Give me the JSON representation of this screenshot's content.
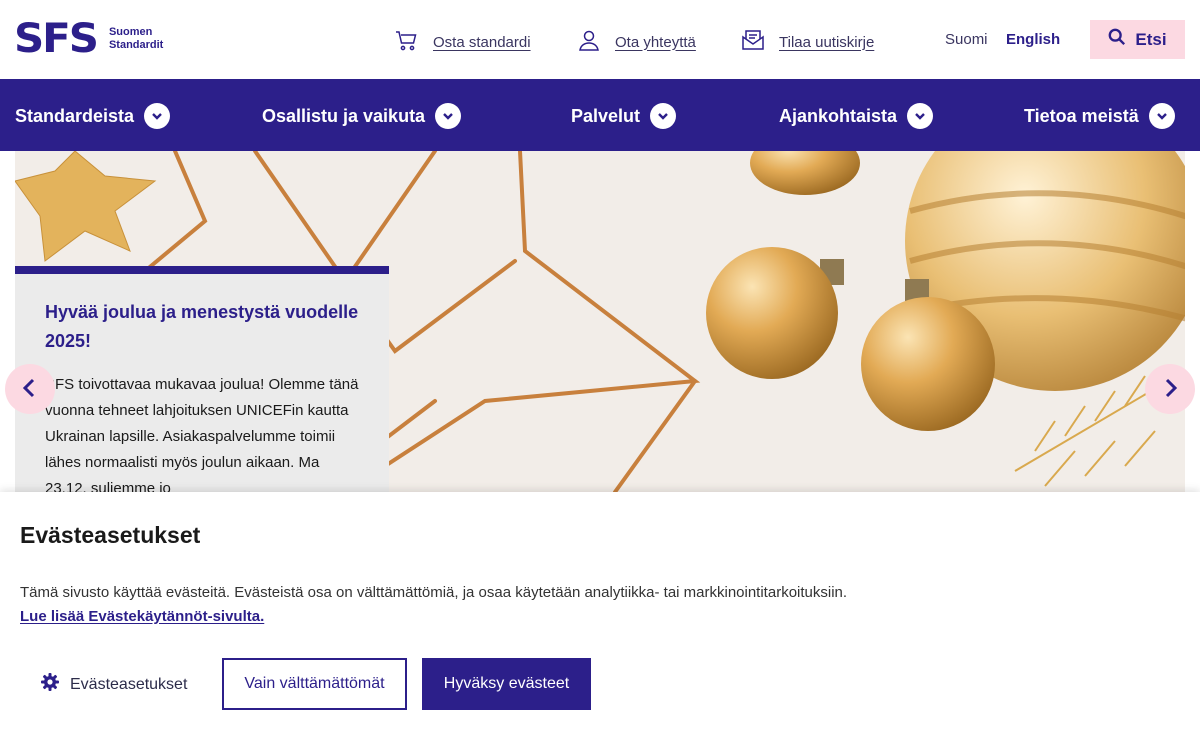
{
  "brand": {
    "mark": "SFS",
    "line1": "Suomen",
    "line2": "Standardit"
  },
  "utility": {
    "buy": "Osta standardi",
    "contact": "Ota yhteyttä",
    "newsletter": "Tilaa uutiskirje"
  },
  "languages": {
    "fi": "Suomi",
    "en": "English"
  },
  "search": {
    "label": "Etsi"
  },
  "nav": [
    {
      "label": "Standardeista"
    },
    {
      "label": "Osallistu ja vaikuta"
    },
    {
      "label": "Palvelut"
    },
    {
      "label": "Ajankohtaista"
    },
    {
      "label": "Tietoa meistä"
    }
  ],
  "hero": {
    "title": "Hyvää joulua ja menestystä vuodelle 2025!",
    "body": "SFS toivottavaa mukavaa joulua! Olemme tänä vuonna tehneet lahjoituksen UNICEFin kautta Ukrainan lapsille. Asiakaspalvelumme toimii lähes normaalisti myös joulun aikaan. Ma 23.12. suljemme jo"
  },
  "cookie": {
    "title": "Evästeasetukset",
    "text": "Tämä sivusto käyttää evästeitä. Evästeistä osa on välttämättömiä, ja osaa käytetään analytiikka- tai markkinointitarkoituksiin.",
    "link": "Lue lisää Evästekäytännöt-sivulta.",
    "settings": "Evästeasetukset",
    "necessary": "Vain välttämättömät",
    "accept": "Hyväksy evästeet"
  },
  "colors": {
    "brand": "#2c1f8a",
    "pink": "#fcd9e2",
    "card": "#ebebeb"
  }
}
